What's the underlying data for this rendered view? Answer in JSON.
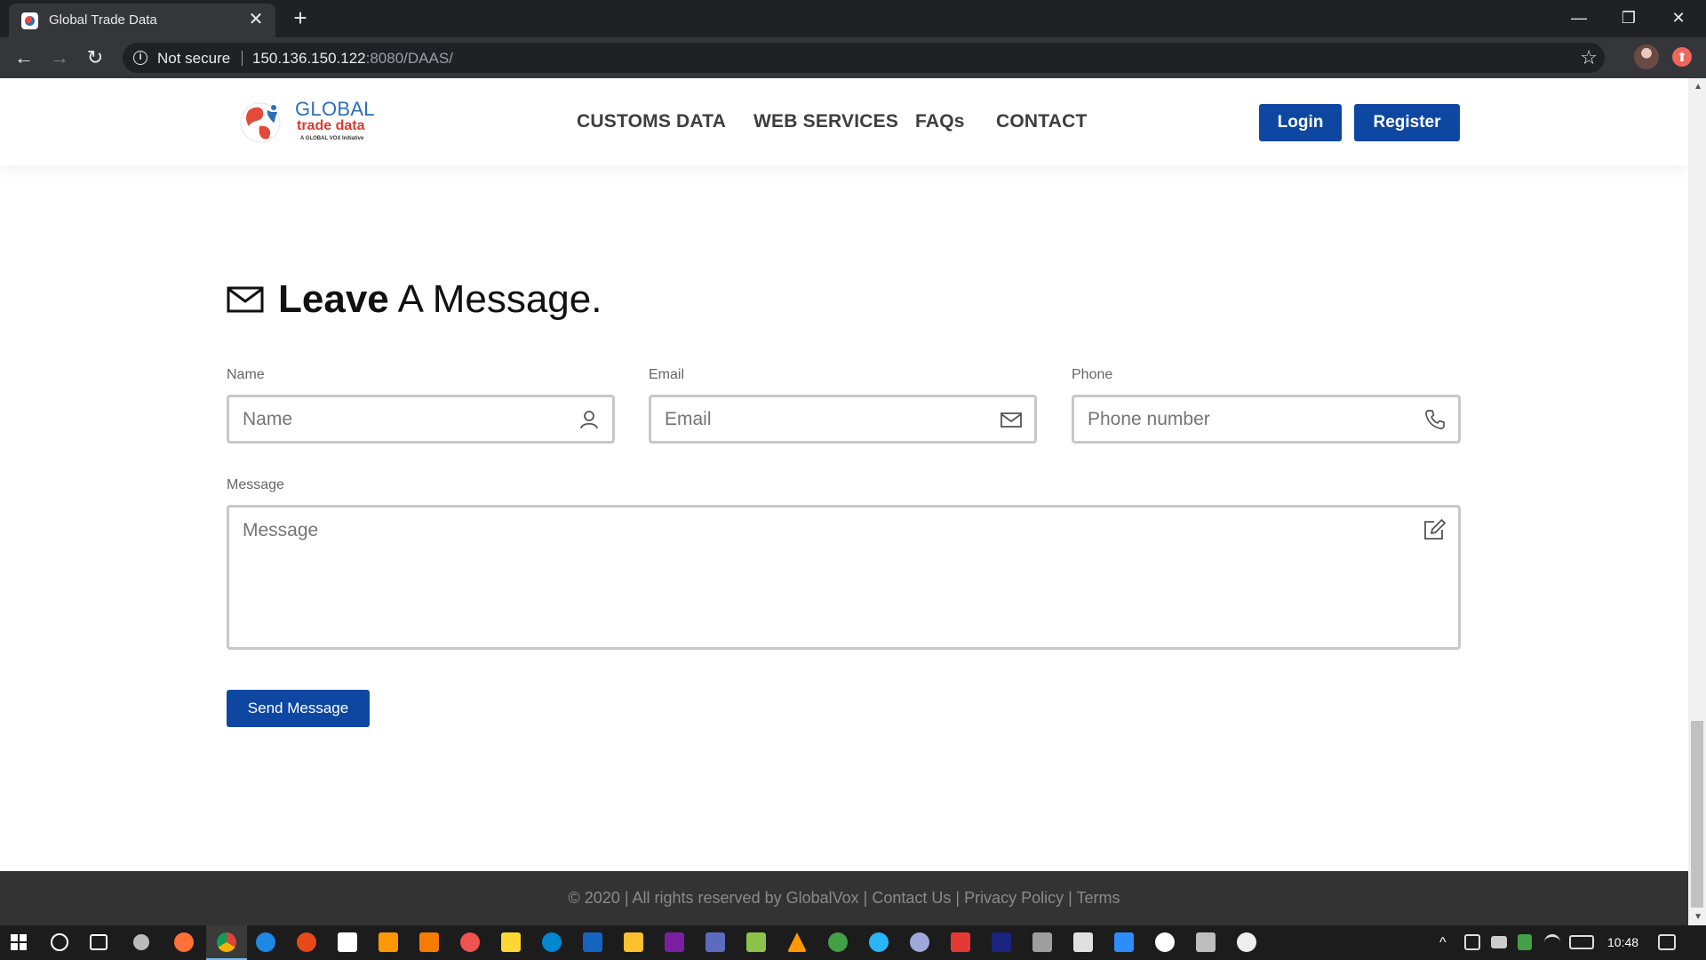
{
  "browser": {
    "tab_title": "Global Trade Data",
    "tab_close": "✕",
    "new_tab": "+",
    "security_label": "Not secure",
    "url_host": "150.136.150.122",
    "url_rest": ":8080/DAAS/",
    "back": "←",
    "forward": "→",
    "reload": "↻",
    "star": "☆",
    "minimize": "—",
    "restore": "❐",
    "close": "✕"
  },
  "header": {
    "logo": {
      "line1": "GLOBAL",
      "line2": "trade data",
      "line3": "A GLOBAL VOX Initiative"
    },
    "nav": [
      {
        "label": "CUSTOMS DATA"
      },
      {
        "label": "WEB SERVICES"
      },
      {
        "label": "FAQs"
      },
      {
        "label": "CONTACT"
      }
    ],
    "login_label": "Login",
    "register_label": "Register"
  },
  "form": {
    "title_bold": "Leave",
    "title_rest": " A Message.",
    "name": {
      "label": "Name",
      "placeholder": "Name",
      "icon": "user-icon"
    },
    "email": {
      "label": "Email",
      "placeholder": "Email",
      "icon": "mail-icon"
    },
    "phone": {
      "label": "Phone",
      "placeholder": "Phone number",
      "icon": "phone-icon"
    },
    "message": {
      "label": "Message",
      "placeholder": "Message",
      "icon": "edit-icon"
    },
    "submit_label": "Send Message"
  },
  "footer": {
    "copyright": "© 2020 | All rights reserved by GlobalVox | ",
    "contact_link": "Contact Us",
    "sep1": " | ",
    "privacy_link": "Privacy Policy",
    "sep2": " | ",
    "terms_link": "Terms"
  },
  "taskbar": {
    "clock": "10:48"
  },
  "colors": {
    "brand_blue": "#0d47a1",
    "logo_red": "#d93b31",
    "logo_blue": "#2d6fb7",
    "footer_bg": "#333333"
  }
}
